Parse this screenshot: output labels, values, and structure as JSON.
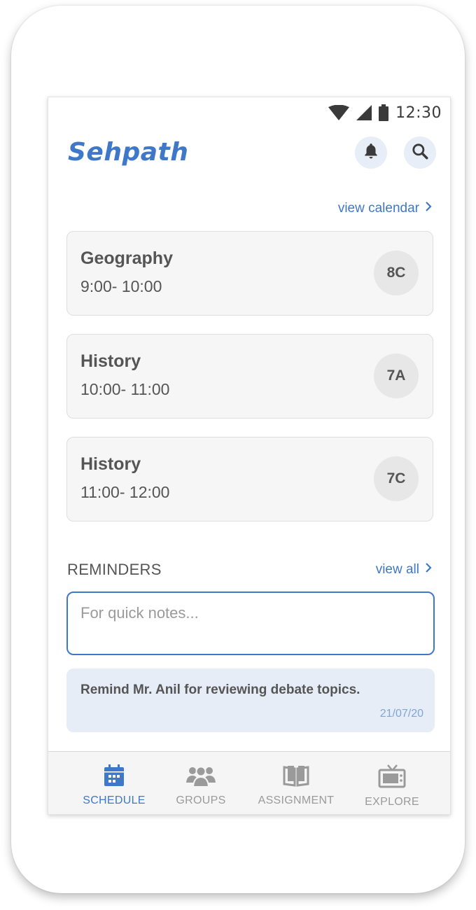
{
  "status_bar": {
    "time": "12:30"
  },
  "app": {
    "title": "Sehpath"
  },
  "header": {
    "notifications_icon": "bell-icon",
    "search_icon": "search-icon"
  },
  "schedule": {
    "view_calendar_label": "view calendar",
    "classes": [
      {
        "subject": "Geography",
        "time": "9:00- 10:00",
        "section": "8C"
      },
      {
        "subject": "History",
        "time": "10:00- 11:00",
        "section": "7A"
      },
      {
        "subject": "History",
        "time": "11:00- 12:00",
        "section": "7C"
      }
    ]
  },
  "reminders": {
    "heading": "REMINDERS",
    "view_all_label": "view all",
    "input_placeholder": "For quick notes...",
    "items": [
      {
        "text": "Remind Mr. Anil for reviewing debate topics.",
        "date": "21/07/20"
      }
    ]
  },
  "bottom_nav": {
    "items": [
      {
        "label": "SCHEDULE",
        "icon": "calendar-icon",
        "active": true
      },
      {
        "label": "GROUPS",
        "icon": "groups-icon",
        "active": false
      },
      {
        "label": "ASSIGNMENT",
        "icon": "book-icon",
        "active": false
      },
      {
        "label": "EXPLORE",
        "icon": "tv-icon",
        "active": false
      }
    ]
  },
  "colors": {
    "accent": "#3f78c8",
    "card_background": "#f6f6f6",
    "reminder_background": "#e6edf7",
    "text_primary": "#555555",
    "inactive_nav": "#9a9a9a"
  }
}
